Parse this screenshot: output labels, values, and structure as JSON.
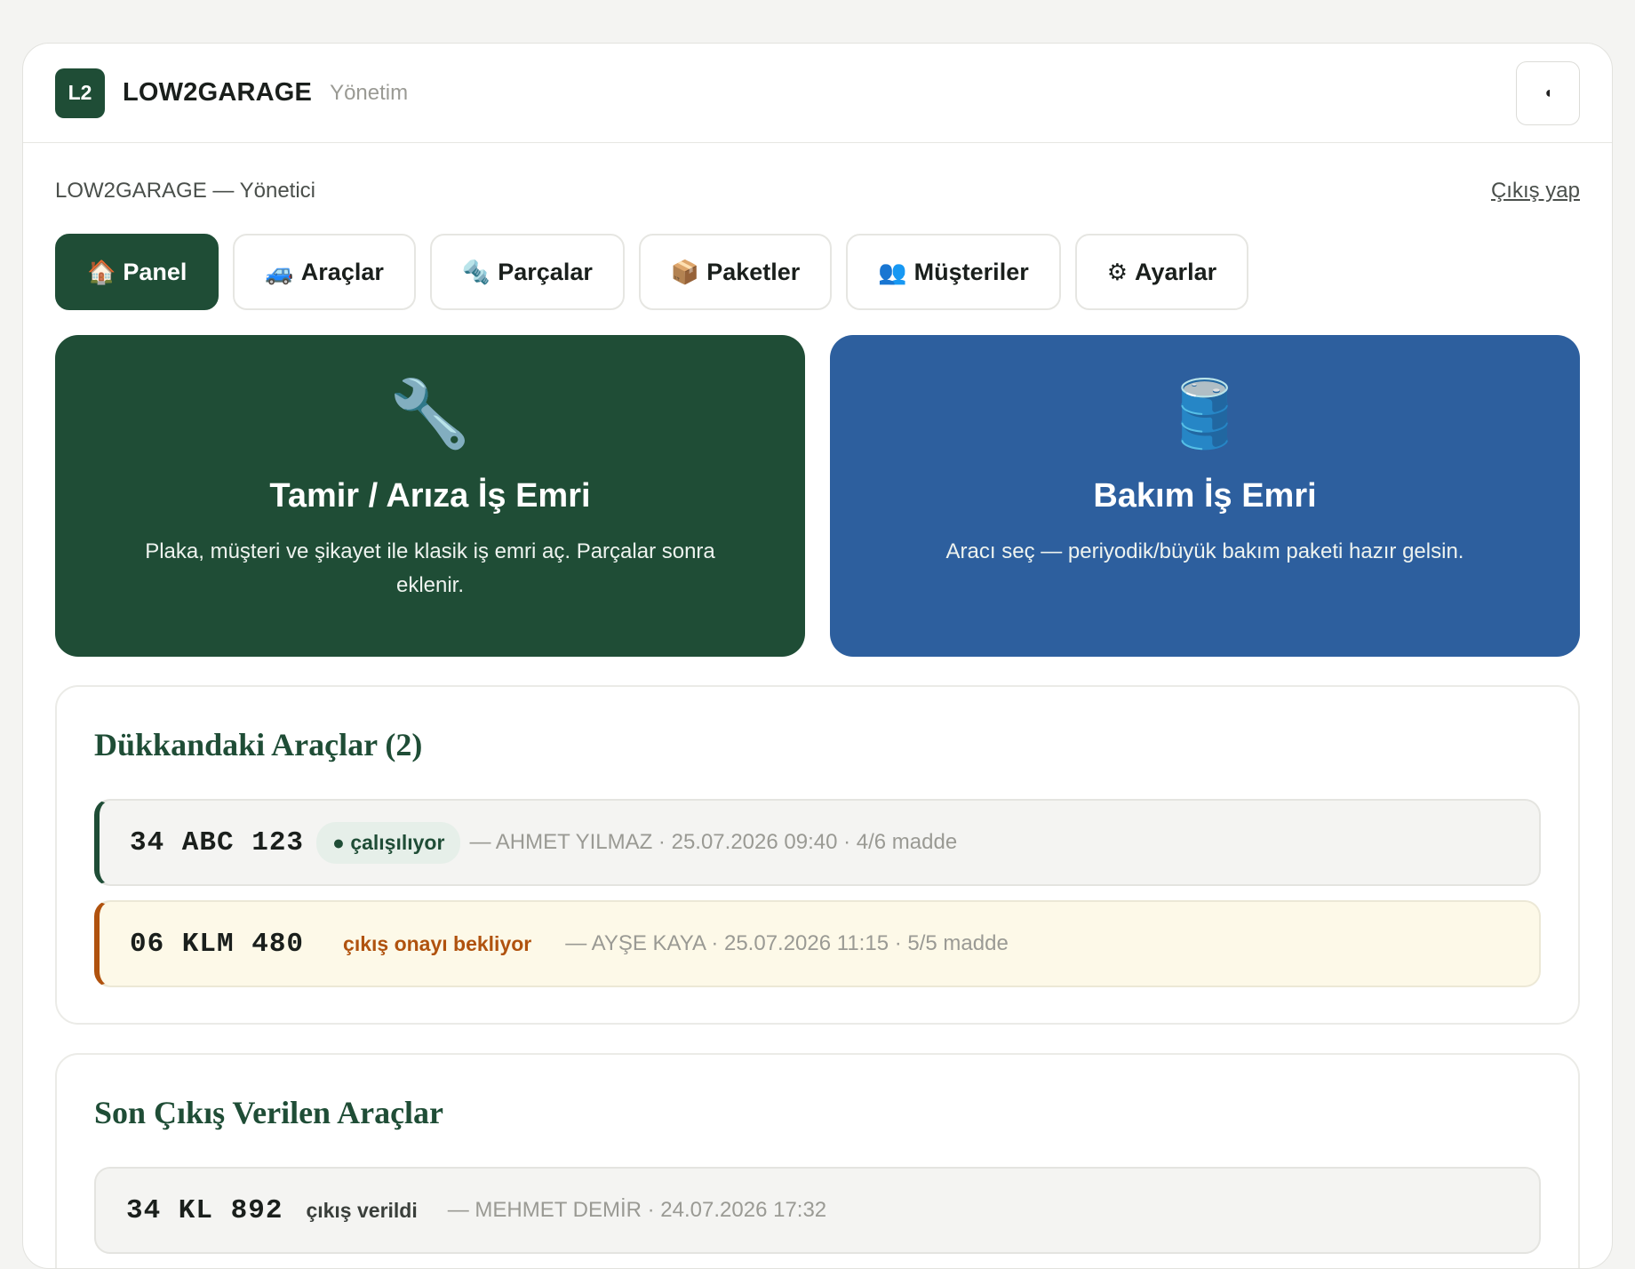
{
  "header": {
    "logo_text": "L2",
    "brand": "LOW2GARAGE",
    "brand_sub": "Yönetim",
    "theme_toggle_icon": "◖"
  },
  "user": {
    "label": "LOW2GARAGE — Yönetici",
    "logout": "Çıkış yap"
  },
  "nav": {
    "tabs": [
      {
        "icon": "🏠",
        "label": "Panel",
        "active": true
      },
      {
        "icon": "🚙",
        "label": "Araçlar",
        "active": false
      },
      {
        "icon": "🔩",
        "label": "Parçalar",
        "active": false
      },
      {
        "icon": "📦",
        "label": "Paketler",
        "active": false
      },
      {
        "icon": "👥",
        "label": "Müşteriler",
        "active": false
      },
      {
        "icon": "⚙",
        "label": "Ayarlar",
        "active": false
      }
    ]
  },
  "hero": {
    "repair": {
      "icon": "🔧",
      "title": "Tamir / Arıza İş Emri",
      "desc": "Plaka, müşteri ve şikayet ile klasik iş emri aç. Parçalar sonra eklenir."
    },
    "maintenance": {
      "icon": "🛢️",
      "title": "Bakım İş Emri",
      "desc": "Aracı seç — periyodik/büyük bakım paketi hazır gelsin."
    }
  },
  "in_shop": {
    "title": "Dükkandaki Araçlar (2)",
    "rows": [
      {
        "plate": "34 ABC 123",
        "status": "● çalışılıyor",
        "meta": "— AHMET YILMAZ · 25.07.2026 09:40 · 4/6 madde"
      },
      {
        "plate": "06 KLM 480",
        "status": "çıkış onayı bekliyor",
        "meta": "— AYŞE KAYA · 25.07.2026 11:15 · 5/5 madde"
      }
    ]
  },
  "released": {
    "title": "Son Çıkış Verilen Araçlar",
    "rows": [
      {
        "plate": "34 KL 892",
        "status": "çıkış verildi",
        "meta": "— MEHMET DEMİR · 24.07.2026 17:32"
      }
    ]
  },
  "colors": {
    "brand_green": "#1f4d36",
    "maintenance_blue": "#2d5f9e",
    "waiting_orange": "#b0520e",
    "background": "#f4f4f2"
  }
}
